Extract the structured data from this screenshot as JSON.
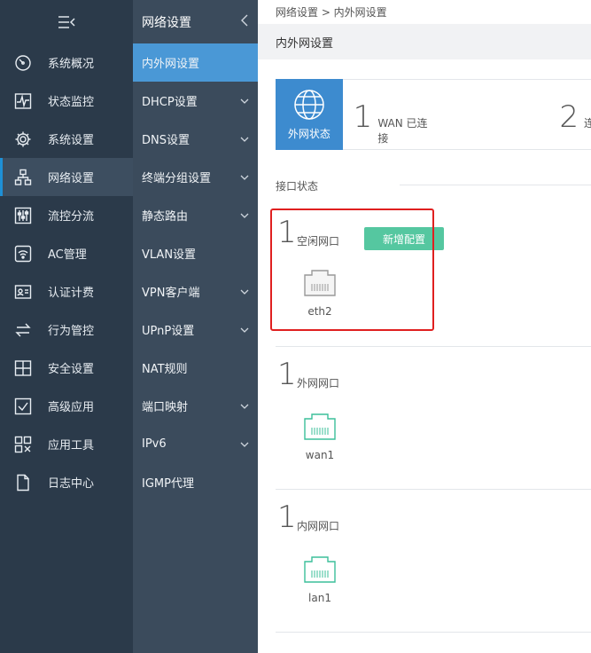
{
  "sidebar": {
    "items": [
      {
        "label": "系统概况",
        "icon": "dashboard-icon"
      },
      {
        "label": "状态监控",
        "icon": "pulse-icon"
      },
      {
        "label": "系统设置",
        "icon": "gear-icon"
      },
      {
        "label": "网络设置",
        "icon": "network-icon"
      },
      {
        "label": "流控分流",
        "icon": "sliders-icon"
      },
      {
        "label": "AC管理",
        "icon": "wifi-icon"
      },
      {
        "label": "认证计费",
        "icon": "id-card-icon"
      },
      {
        "label": "行为管控",
        "icon": "swap-icon"
      },
      {
        "label": "安全设置",
        "icon": "shield-grid-icon"
      },
      {
        "label": "高级应用",
        "icon": "check-box-icon"
      },
      {
        "label": "应用工具",
        "icon": "tools-icon"
      },
      {
        "label": "日志中心",
        "icon": "document-icon"
      }
    ],
    "active_index": 3
  },
  "subnav": {
    "title": "网络设置",
    "items": [
      {
        "label": "内外网设置",
        "chevron": false
      },
      {
        "label": "DHCP设置",
        "chevron": true
      },
      {
        "label": "DNS设置",
        "chevron": true
      },
      {
        "label": "终端分组设置",
        "chevron": true
      },
      {
        "label": "静态路由",
        "chevron": true
      },
      {
        "label": "VLAN设置",
        "chevron": false
      },
      {
        "label": "VPN客户端",
        "chevron": true
      },
      {
        "label": "UPnP设置",
        "chevron": true
      },
      {
        "label": "NAT规则",
        "chevron": false
      },
      {
        "label": "端口映射",
        "chevron": true
      },
      {
        "label": "IPv6",
        "chevron": true
      },
      {
        "label": "IGMP代理",
        "chevron": false
      }
    ]
  },
  "breadcrumb": "网络设置 > 内外网设置",
  "page_title": "内外网设置",
  "status": {
    "tile_label": "外网状态",
    "wan_count": "1",
    "wan_label": "WAN 已连接",
    "second_count": "2",
    "second_label": "连"
  },
  "interfaces_label": "接口状态",
  "groups": [
    {
      "count": "1",
      "name": "空闲网口",
      "button": "新增配置",
      "ports": [
        "eth2"
      ],
      "color": "#999999"
    },
    {
      "count": "1",
      "name": "外网网口",
      "ports": [
        "wan1"
      ],
      "color": "#3bbf9a"
    },
    {
      "count": "1",
      "name": "内网网口",
      "ports": [
        "lan1"
      ],
      "color": "#3bbf9a"
    }
  ],
  "colors": {
    "sidebar_bg": "#2b3a4a",
    "subnav_bg": "#3b4b5c",
    "accent": "#4a98d6",
    "status_tile": "#3d8bcf",
    "add_button": "#55c7a0",
    "highlight": "#e02020"
  }
}
